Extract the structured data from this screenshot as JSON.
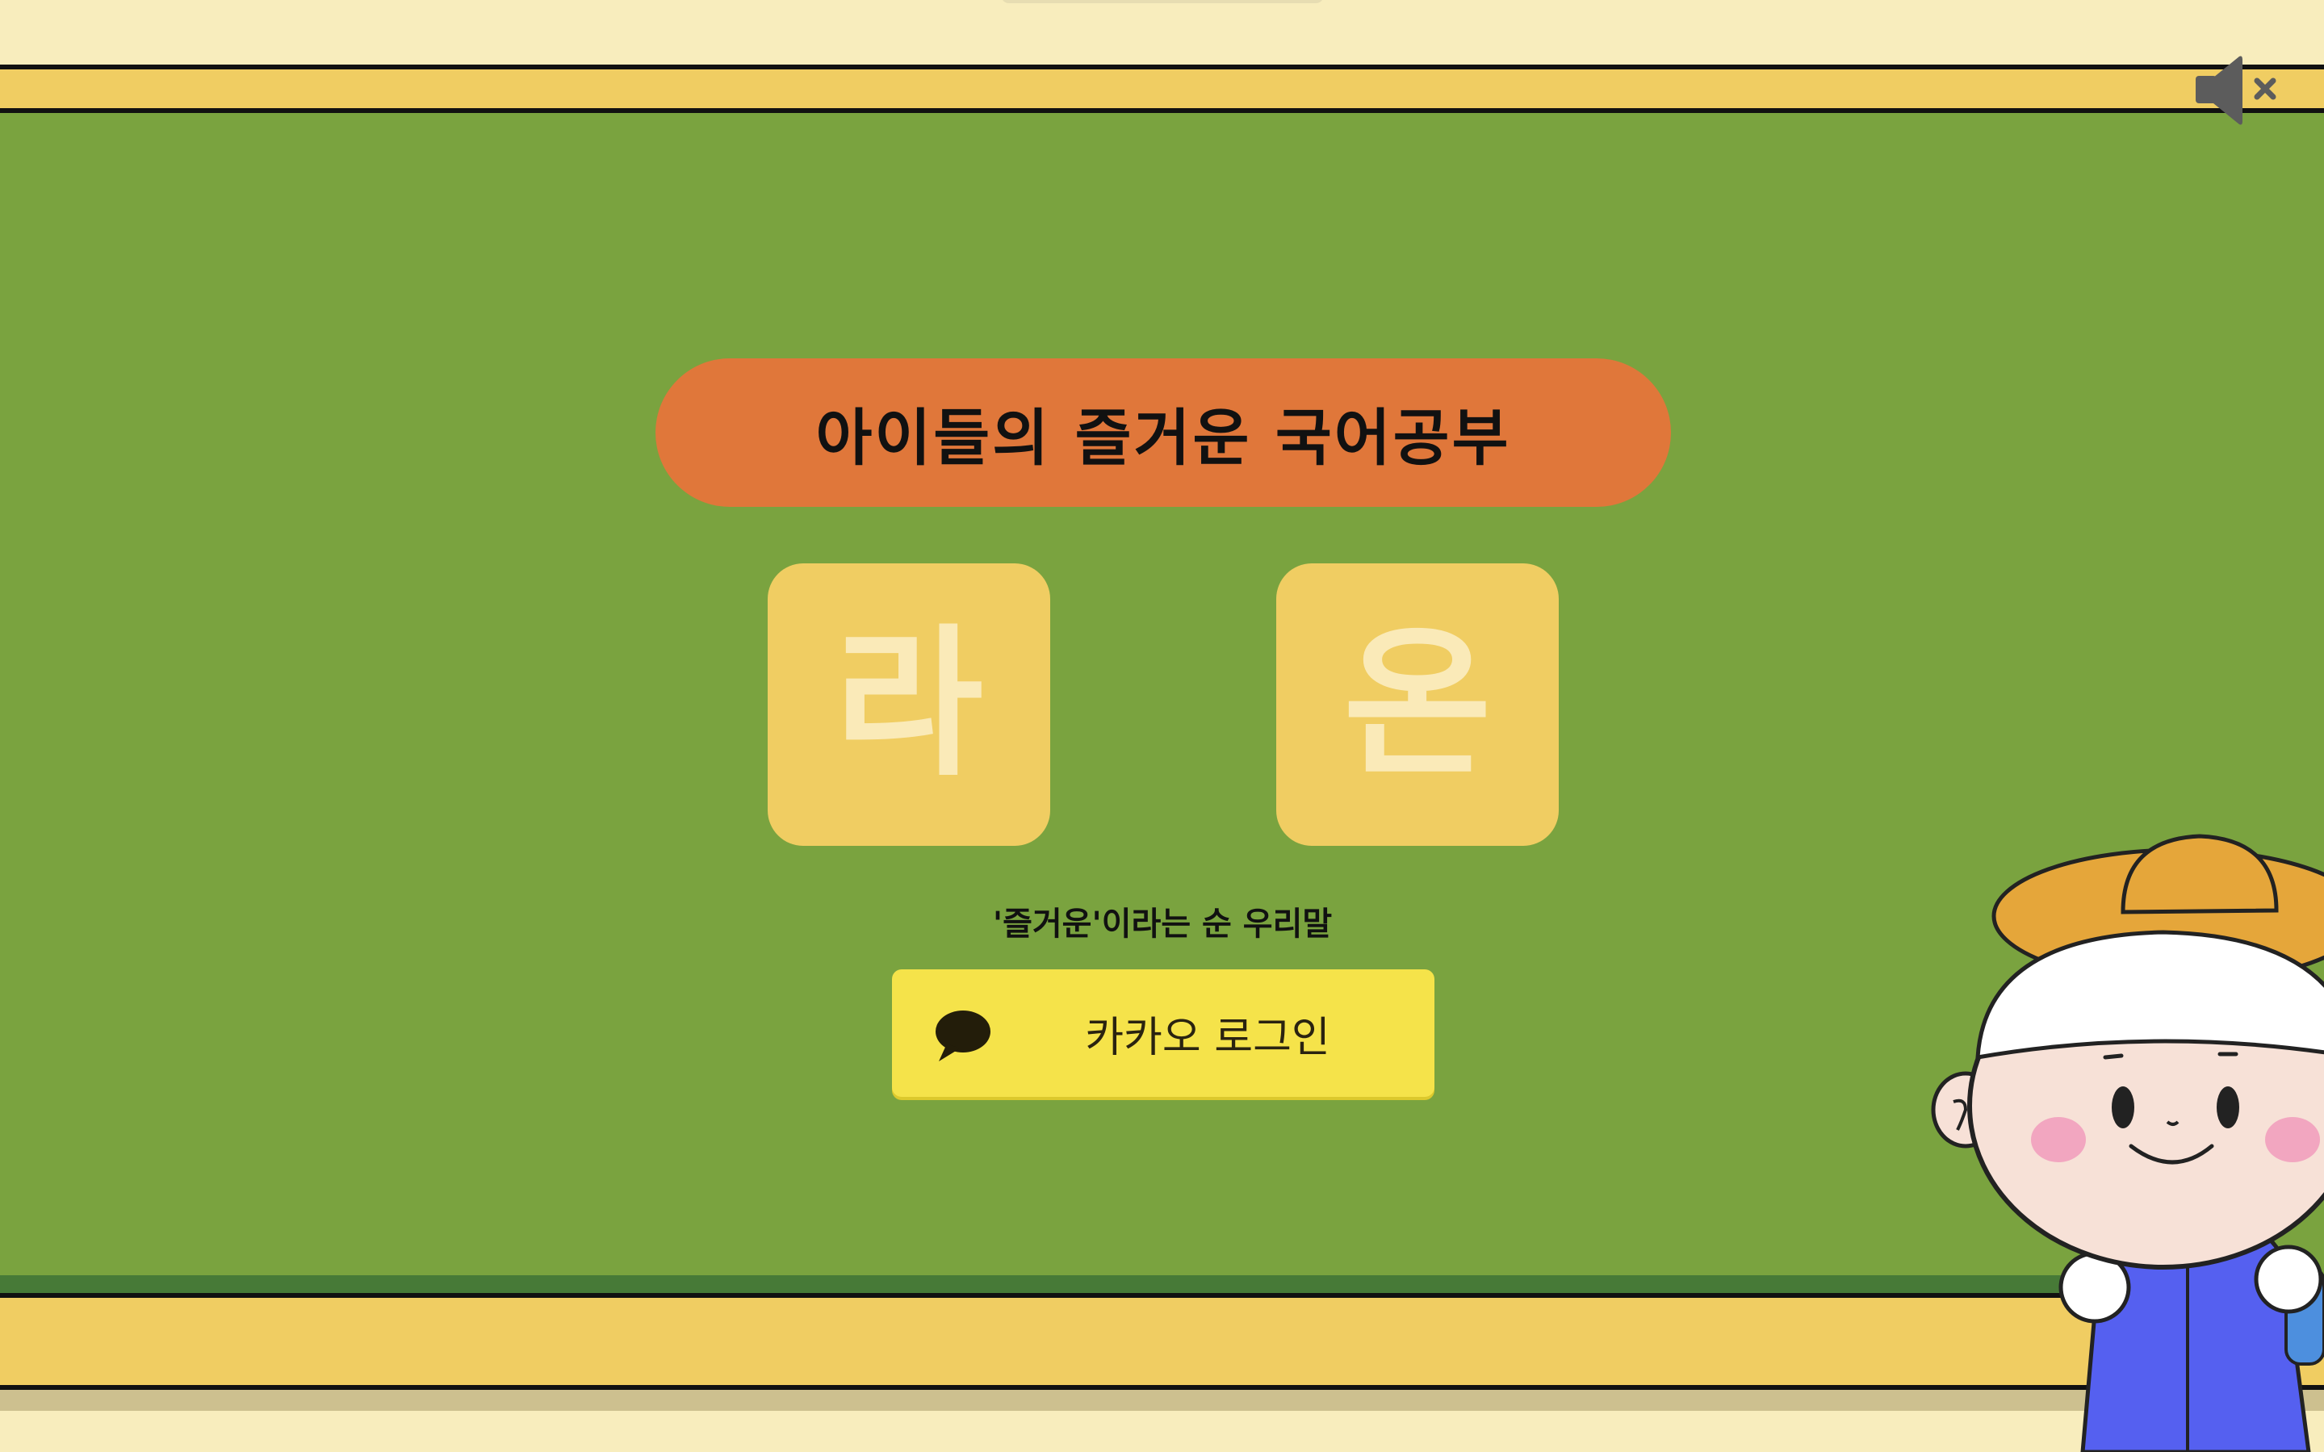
{
  "header": {
    "title": "아이들의 즐거운 국어공부"
  },
  "tiles": [
    {
      "char": "라"
    },
    {
      "char": "온"
    }
  ],
  "subtitle": "'즐거운'이라는 순 우리말",
  "login": {
    "label": "카카오 로그인",
    "icon": "speech-bubble-icon"
  },
  "controls": {
    "sound_icon": "speaker-muted-icon"
  },
  "colors": {
    "board": "#7aa33f",
    "frame": "#f0cd62",
    "title_pill": "#e0773a",
    "kakao": "#f5e34a",
    "tile_text": "#faeab8"
  }
}
